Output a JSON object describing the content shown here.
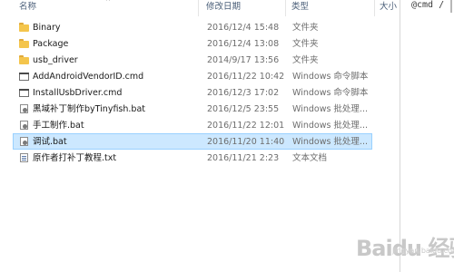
{
  "header": {
    "name": "名称",
    "date": "修改日期",
    "type": "类型",
    "size": "大小"
  },
  "files": [
    {
      "name": "Binary",
      "date": "2016/12/4 15:48",
      "type": "文件夹",
      "icon": "folder-icon",
      "selected": false
    },
    {
      "name": "Package",
      "date": "2016/12/4 13:08",
      "type": "文件夹",
      "icon": "folder-icon",
      "selected": false
    },
    {
      "name": "usb_driver",
      "date": "2014/9/17 13:56",
      "type": "文件夹",
      "icon": "folder-icon",
      "selected": false
    },
    {
      "name": "AddAndroidVendorID.cmd",
      "date": "2016/11/22 10:42",
      "type": "Windows 命令脚本",
      "icon": "cmd-file-icon",
      "selected": false
    },
    {
      "name": "InstallUsbDriver.cmd",
      "date": "2016/12/3 17:02",
      "type": "Windows 命令脚本",
      "icon": "cmd-file-icon",
      "selected": false
    },
    {
      "name": "黑域补丁制作byTinyfish.bat",
      "date": "2016/12/5 23:55",
      "type": "Windows 批处理...",
      "icon": "bat-file-icon",
      "selected": false
    },
    {
      "name": "手工制作.bat",
      "date": "2016/11/22 12:01",
      "type": "Windows 批处理...",
      "icon": "bat-file-icon",
      "selected": false
    },
    {
      "name": "调试.bat",
      "date": "2016/11/20 11:40",
      "type": "Windows 批处理...",
      "icon": "bat-file-icon",
      "selected": true
    },
    {
      "name": "原作者打补丁教程.txt",
      "date": "2016/11/21 2:23",
      "type": "文本文档",
      "icon": "text-file-icon",
      "selected": false
    }
  ],
  "side_panel": {
    "text": "@cmd /"
  },
  "watermark": {
    "main": "Baidu 经验",
    "sub": "jingyan.baidu.com"
  }
}
